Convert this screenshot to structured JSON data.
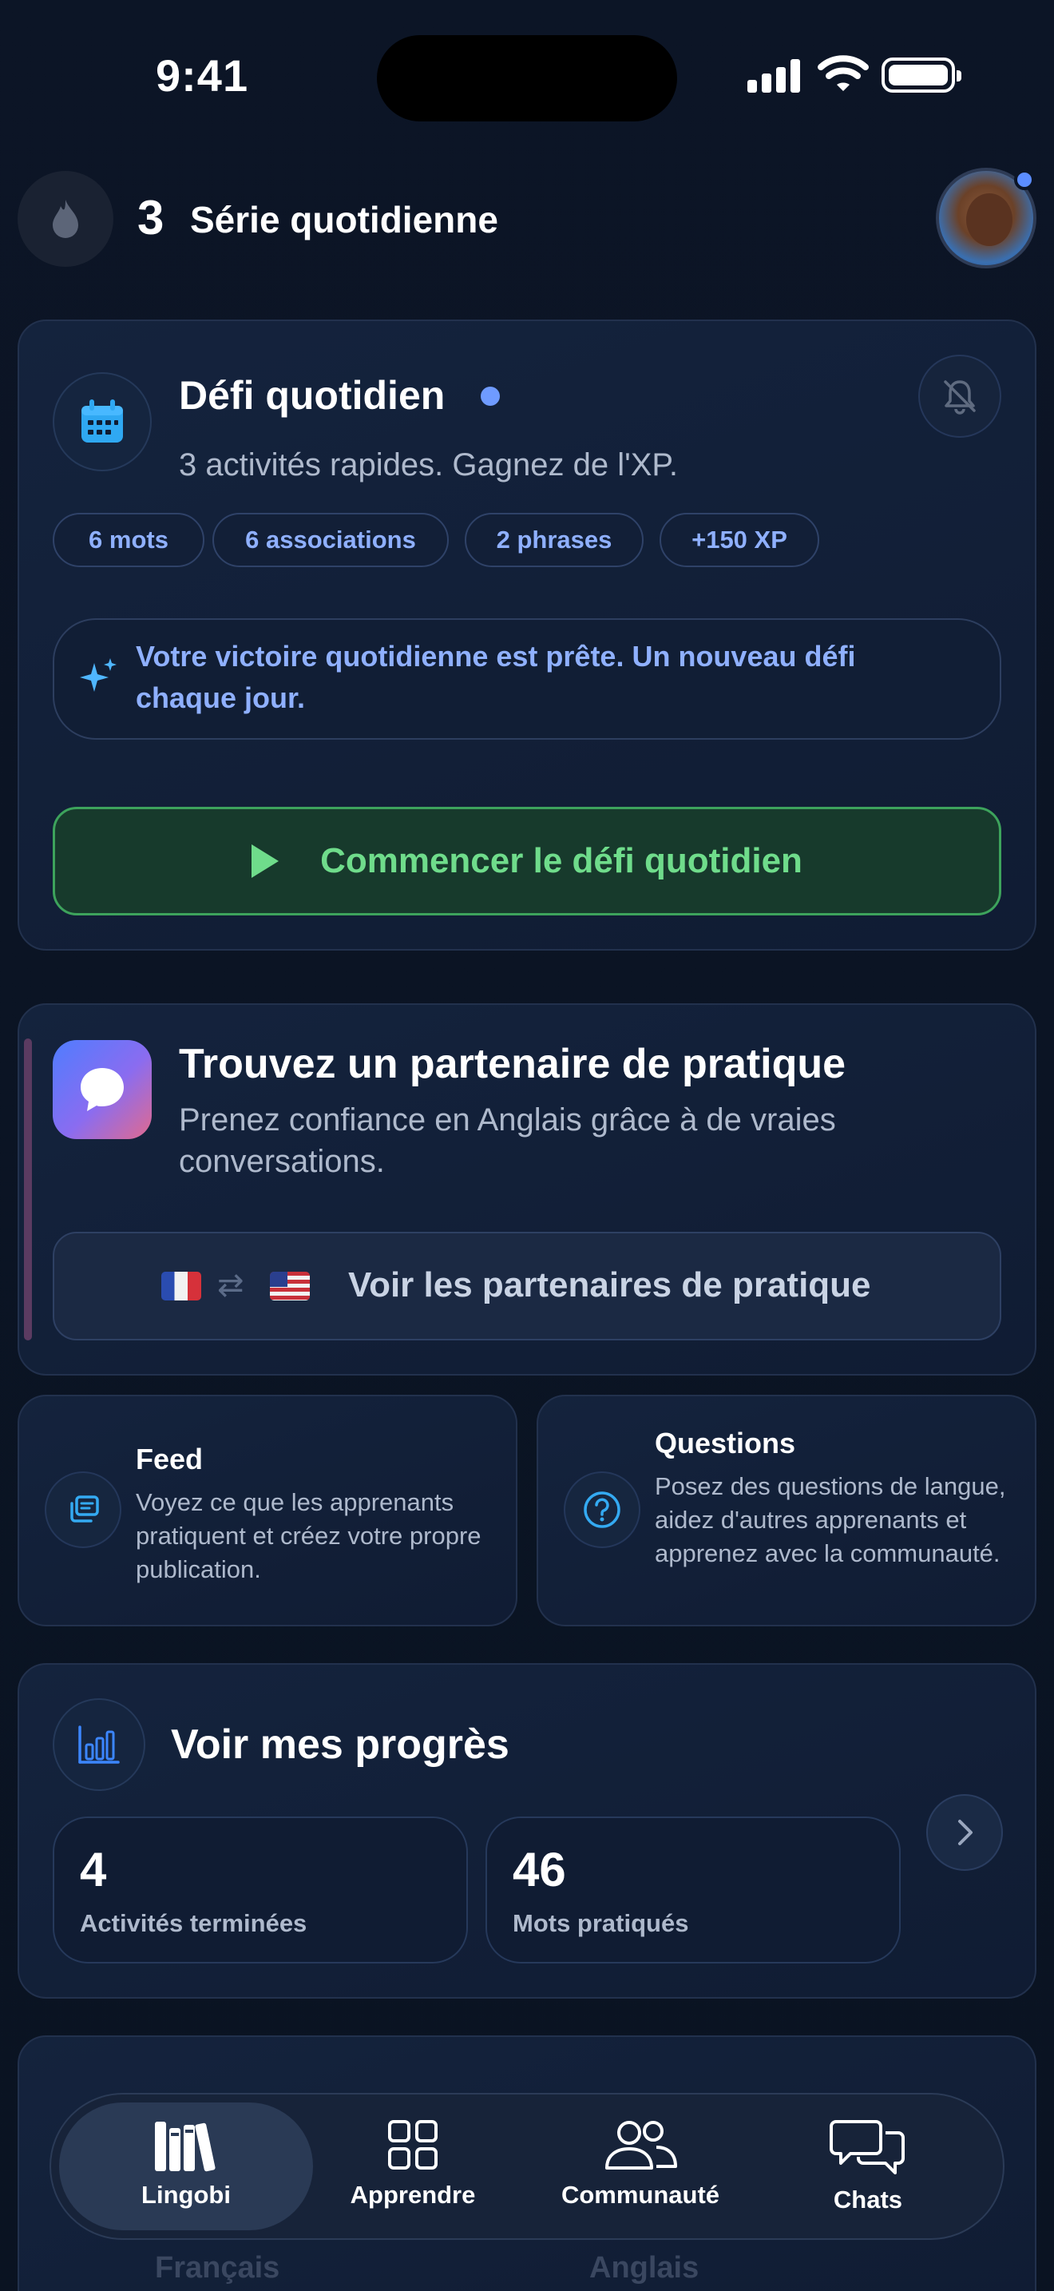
{
  "status_bar": {
    "time": "9:41"
  },
  "header": {
    "streak_count": "3",
    "streak_label": "Série quotidienne"
  },
  "daily_challenge": {
    "title": "Défi quotidien",
    "subtitle": "3 activités rapides. Gagnez de l'XP.",
    "chips": [
      "6 mots",
      "6 associations",
      "2 phrases",
      "+150 XP"
    ],
    "victory_text": "Votre victoire quotidienne est prête. Un nouveau défi chaque jour.",
    "start_label": "Commencer le défi quotidien"
  },
  "partner": {
    "title": "Trouvez un partenaire de pratique",
    "subtitle": "Prenez confiance en Anglais grâce à de vraies conversations.",
    "button_label": "Voir les partenaires de pratique",
    "swap_symbol": "⇄"
  },
  "feed": {
    "title": "Feed",
    "text": "Voyez ce que les apprenants pratiquent et créez votre propre publication."
  },
  "questions": {
    "title": "Questions",
    "text": "Posez des questions de langue, aidez d'autres apprenants et apprenez avec la communauté."
  },
  "progress": {
    "title": "Voir mes progrès",
    "stats": [
      {
        "value": "4",
        "label": "Activités terminées"
      },
      {
        "value": "46",
        "label": "Mots pratiqués"
      }
    ]
  },
  "languages": {
    "source": "Français",
    "target": "Anglais"
  },
  "tabbar": {
    "tabs": [
      {
        "label": "Lingobi",
        "icon": "library-icon",
        "active": true
      },
      {
        "label": "Apprendre",
        "icon": "grid-icon",
        "active": false
      },
      {
        "label": "Communauté",
        "icon": "people-icon",
        "active": false
      },
      {
        "label": "Chats",
        "icon": "chat-bubbles-icon",
        "active": false
      }
    ]
  },
  "colors": {
    "background": "#0b1424",
    "accent_blue": "#8fb0ff",
    "accent_green": "#6fdc8b",
    "card": "#14233d"
  }
}
